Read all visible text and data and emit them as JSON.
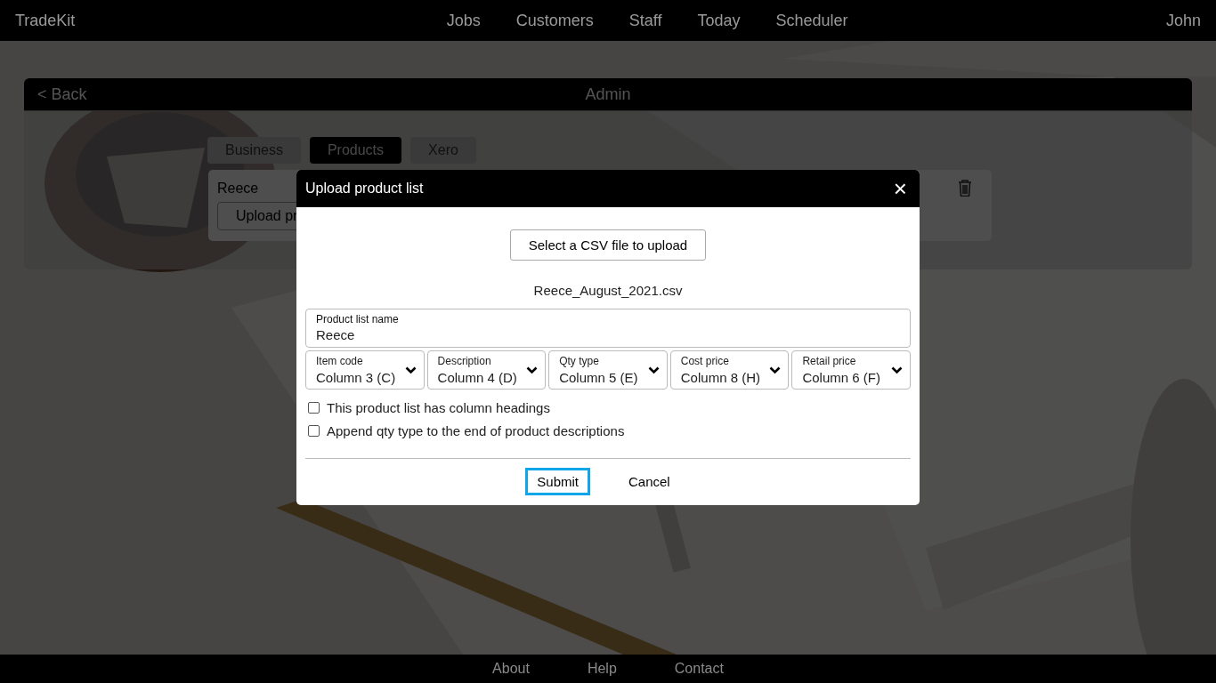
{
  "nav": {
    "brand": "TradeKit",
    "links": [
      "Jobs",
      "Customers",
      "Staff",
      "Today",
      "Scheduler"
    ],
    "user": "John"
  },
  "admin": {
    "back": "< Back",
    "title": "Admin",
    "tabs": [
      {
        "label": "Business",
        "selected": false
      },
      {
        "label": "Products",
        "selected": true
      },
      {
        "label": "Xero",
        "selected": false
      }
    ],
    "product_list": {
      "name": "Reece",
      "upload_button": "Upload pr"
    }
  },
  "modal": {
    "title": "Upload product list",
    "close": "×",
    "select_button": "Select a CSV file to upload",
    "file_name": "Reece_August_2021.csv",
    "name_field": {
      "label": "Product list name",
      "value": "Reece"
    },
    "columns": [
      {
        "label": "Item code",
        "value": "Column 3 (C)"
      },
      {
        "label": "Description",
        "value": "Column 4 (D)"
      },
      {
        "label": "Qty type",
        "value": "Column 5 (E)"
      },
      {
        "label": "Cost price",
        "value": "Column 8 (H)"
      },
      {
        "label": "Retail price",
        "value": "Column 6 (F)"
      }
    ],
    "options": [
      {
        "label": "This product list has column headings",
        "checked": false
      },
      {
        "label": "Append qty type to the end of product descriptions",
        "checked": false
      }
    ],
    "buttons": [
      {
        "label": "Submit",
        "focused": true
      },
      {
        "label": "Cancel",
        "focused": false
      }
    ]
  },
  "footer": {
    "links": [
      "About",
      "Help",
      "Contact"
    ]
  }
}
